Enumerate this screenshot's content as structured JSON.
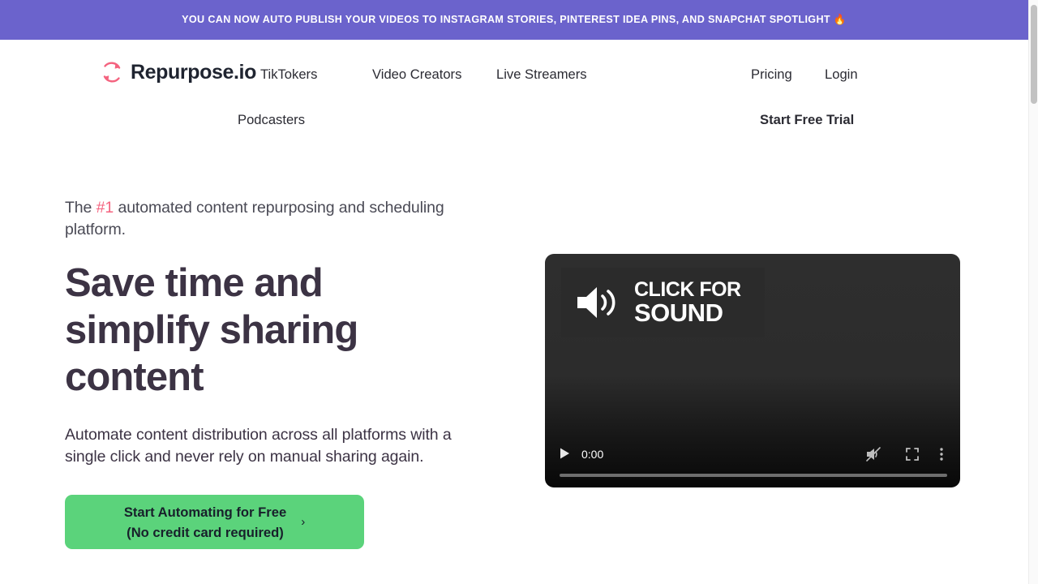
{
  "announcement": {
    "text": "YOU CAN NOW AUTO PUBLISH YOUR VIDEOS TO INSTAGRAM STORIES, PINTEREST IDEA PINS, AND SNAPCHAT SPOTLIGHT 🔥",
    "background_color": "#6B63CC",
    "text_color": "#FFFFFF"
  },
  "header": {
    "brand": {
      "name": "Repurpose.io",
      "icon": "repurpose-loop-icon",
      "icon_color": "#F4637F",
      "text_color": "#1F2430"
    },
    "nav": [
      {
        "label": "TikTokers"
      },
      {
        "label": "Video Creators"
      },
      {
        "label": "Live Streamers"
      },
      {
        "label": "Podcasters"
      }
    ],
    "actions": [
      {
        "label": "Pricing"
      },
      {
        "label": "Login"
      },
      {
        "label": "Start Free Trial"
      }
    ]
  },
  "hero": {
    "eyebrow_before": "The ",
    "eyebrow_accent": "#1",
    "eyebrow_after": " automated content repurposing and scheduling platform.",
    "accent_color": "#F4637F",
    "headline": "Save time and simplify sharing content",
    "subcopy": "Automate content distribution across all platforms with a single click and never rely on manual sharing again.",
    "cta": {
      "label": "Start Automating for Free\n(No credit card required)",
      "chevron": "›",
      "background_color": "#5BD37B",
      "text_color": "#18202B"
    }
  },
  "video": {
    "sound_badge": {
      "line1": "CLICK FOR",
      "line2": "SOUND",
      "icon": "speaker-waves-icon"
    },
    "controls": {
      "play": "play-icon",
      "current_time": "0:00",
      "mute": "volume-muted-icon",
      "fullscreen": "fullscreen-icon",
      "more": "more-options-icon",
      "progress_percent": 0
    }
  },
  "scrollbar": {
    "thumb_position_percent": 0
  }
}
